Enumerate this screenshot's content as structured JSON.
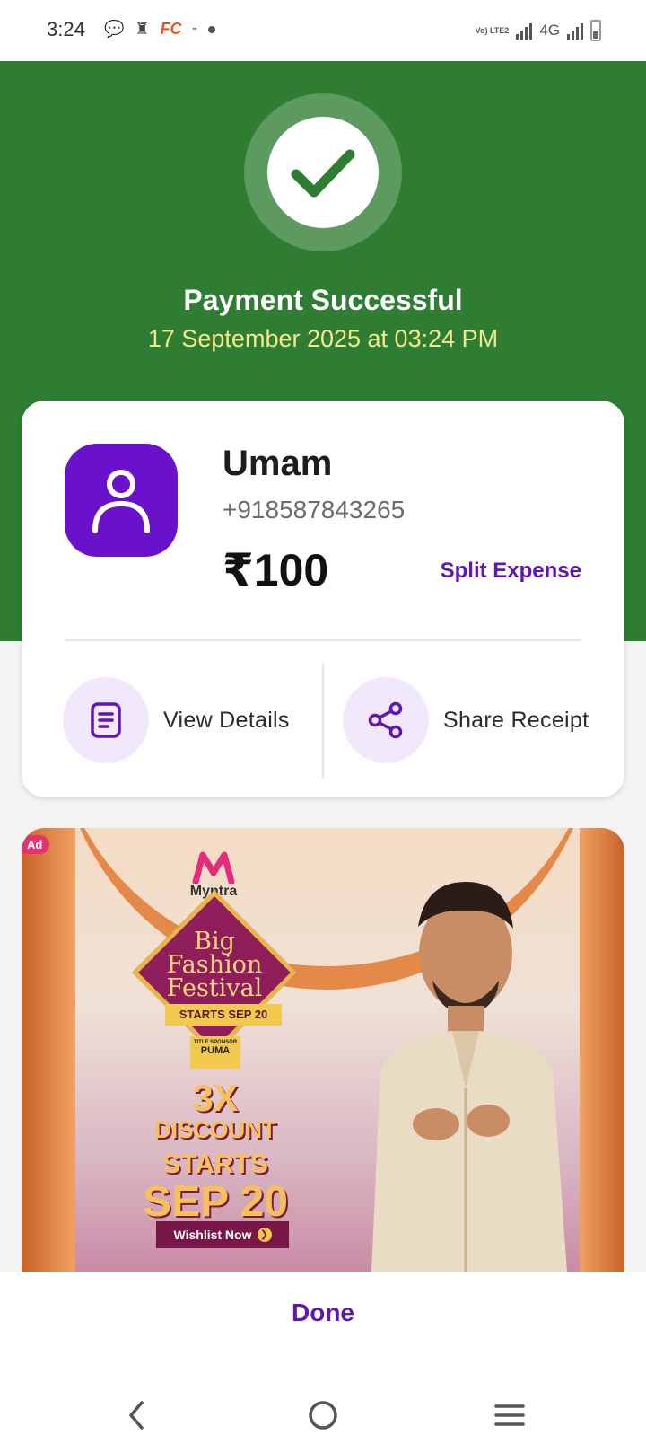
{
  "status_bar": {
    "time": "3:24",
    "icons": [
      "chat-icon",
      "notification-icon",
      "fc-app-icon",
      "small-app-icon",
      "dot-icon"
    ],
    "fc_label": "FC",
    "volte_label": "Vo) LTE2",
    "network_label": "4G",
    "battery_icon": "battery-icon"
  },
  "header": {
    "status_icon": "checkmark-icon",
    "title": "Payment Successful",
    "datetime": "17 September 2025 at 03:24 PM",
    "bg_color": "#2e7d32"
  },
  "payee": {
    "avatar_icon": "person-icon",
    "name": "Umam",
    "phone": "+918587843265",
    "amount": "₹100",
    "split_label": "Split Expense"
  },
  "actions": [
    {
      "label": "View Details",
      "icon": "document-icon"
    },
    {
      "label": "Share Receipt",
      "icon": "share-icon"
    }
  ],
  "ad": {
    "badge": "Ad",
    "brand": "Myntra",
    "festival_lines": [
      "Big",
      "Fashion",
      "Festival"
    ],
    "starts_ribbon": "STARTS SEP 20",
    "sponsor_title": "TITLE SPONSOR",
    "sponsor_name": "PUMA",
    "discount_big": "3X",
    "discount_word": "DISCOUNT",
    "starts_word": "STARTS",
    "sep_date": "SEP 20",
    "cta": "Wishlist Now"
  },
  "footer": {
    "done_label": "Done"
  },
  "nav": {
    "back_icon": "back-icon",
    "home_icon": "home-icon",
    "menu_icon": "menu-icon"
  },
  "colors": {
    "accent": "#5e17b5",
    "success": "#2e7d32",
    "date_text": "#f2ea8b"
  }
}
